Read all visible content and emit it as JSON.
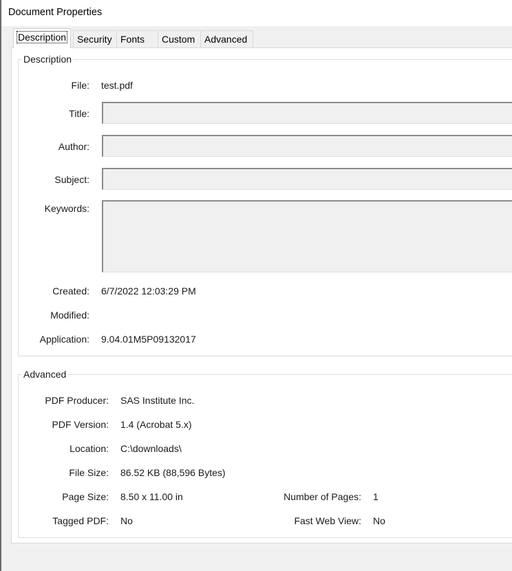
{
  "window": {
    "title": "Document Properties"
  },
  "tabs": [
    {
      "label": "Description",
      "active": true
    },
    {
      "label": "Security"
    },
    {
      "label": "Fonts"
    },
    {
      "label": "Custom"
    },
    {
      "label": "Advanced"
    }
  ],
  "description": {
    "legend": "Description",
    "file_label": "File:",
    "file_value": "test.pdf",
    "title_label": "Title:",
    "title_value": "",
    "author_label": "Author:",
    "author_value": "",
    "subject_label": "Subject:",
    "subject_value": "",
    "keywords_label": "Keywords:",
    "keywords_value": "",
    "created_label": "Created:",
    "created_value": "6/7/2022 12:03:29 PM",
    "modified_label": "Modified:",
    "modified_value": "",
    "application_label": "Application:",
    "application_value": "9.04.01M5P09132017"
  },
  "advanced": {
    "legend": "Advanced",
    "producer_label": "PDF Producer:",
    "producer_value": "SAS Institute Inc.",
    "version_label": "PDF Version:",
    "version_value": "1.4 (Acrobat 5.x)",
    "location_label": "Location:",
    "location_value": "C:\\downloads\\",
    "filesize_label": "File Size:",
    "filesize_value": "86.52 KB (88,596 Bytes)",
    "pagesize_label": "Page Size:",
    "pagesize_value": "8.50 x 11.00 in",
    "pages_label": "Number of Pages:",
    "pages_value": "1",
    "tagged_label": "Tagged PDF:",
    "tagged_value": "No",
    "fastweb_label": "Fast Web View:",
    "fastweb_value": "No"
  }
}
